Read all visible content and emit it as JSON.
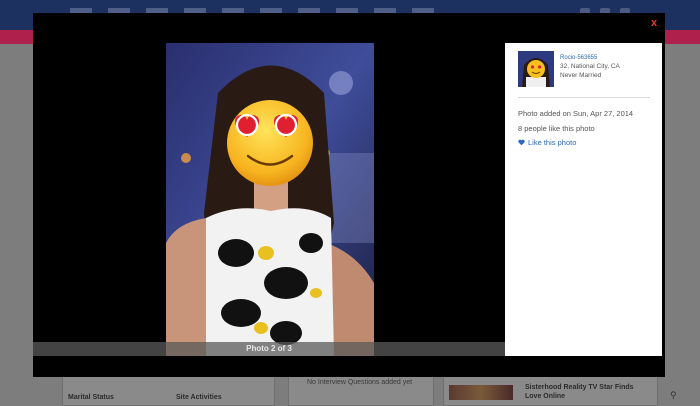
{
  "background": {
    "left_card": {
      "marital_label": "Marital Status",
      "site_label": "Site Activities"
    },
    "middle_card": {
      "interview_text": "No Interview Questions added yet"
    },
    "right_card": {
      "headline_line1": "Sisterhood Reality TV Star Finds",
      "headline_line2": "Love Online"
    }
  },
  "modal": {
    "close_label": "x",
    "caption": "Photo 2 of 3",
    "profile": {
      "username": "Rocio-563655",
      "location": "32, National City, CA",
      "status": "Never Married"
    },
    "photo_added": "Photo added on Sun, Apr 27, 2014",
    "likes_text": "8 people like this photo",
    "like_link": "Like this photo"
  },
  "colors": {
    "accent_link": "#2a6ab8",
    "close": "#e53b2c",
    "nav": "#1d3160",
    "brand_bar": "#b0204d"
  }
}
